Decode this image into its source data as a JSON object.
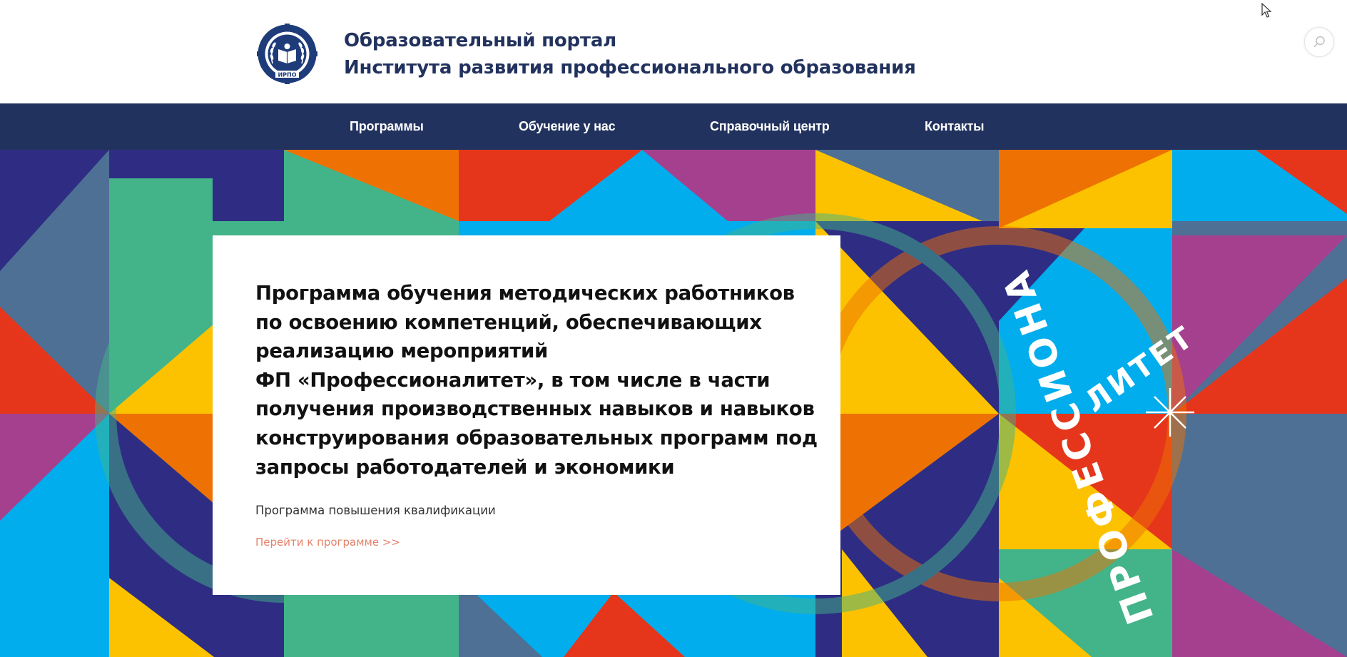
{
  "header": {
    "logo_text": "ИРПО",
    "title_line1": "Образовательный портал",
    "title_line2": "Института развития профессионального образования",
    "search_icon": "search-icon"
  },
  "nav": {
    "items": [
      {
        "label": "Программы"
      },
      {
        "label": "Обучение у нас"
      },
      {
        "label": "Справочный центр"
      },
      {
        "label": "Контакты"
      }
    ]
  },
  "hero": {
    "emblem_word1": "ПРОФЕССИОНА",
    "emblem_word2": "ЛИТЕТ",
    "colors": {
      "navy": "#2e2d83",
      "green": "#43b48a",
      "orange": "#ee7203",
      "yellow": "#fcc200",
      "red": "#e5361b",
      "purple": "#a5408e",
      "cyan": "#01adec",
      "steel": "#4e7095"
    }
  },
  "card": {
    "title_lines": [
      "Программа обучения методических работников",
      "по освоению компетенций, обеспечивающих",
      "реализацию мероприятий",
      "ФП «Профессионалитет», в том числе в части",
      "получения производственных навыков и навыков",
      "конструирования образовательных программ под",
      "запросы работодателей и экономики"
    ],
    "subtitle": "Программа повышения квалификации",
    "link": "Перейти к программе >>"
  },
  "colors": {
    "brand_navy": "#22325e",
    "link": "#e4826a"
  }
}
